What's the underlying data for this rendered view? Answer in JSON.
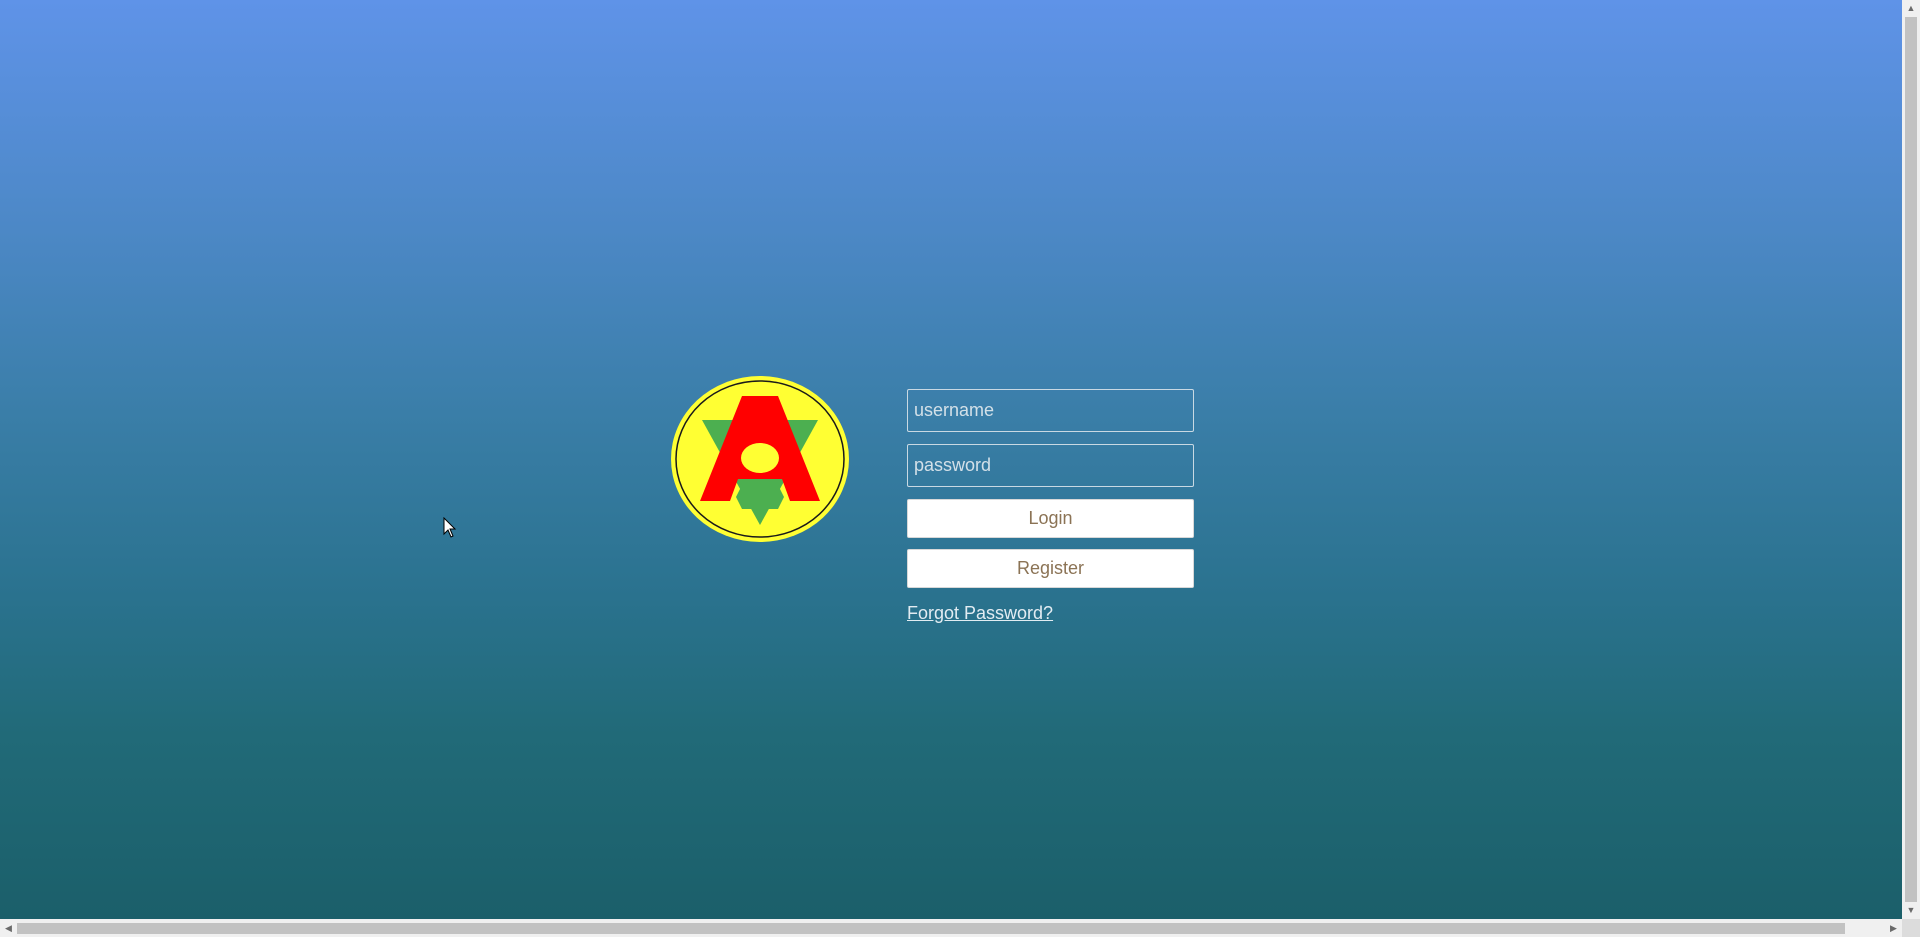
{
  "logo": {
    "icon": "club-emblem-logo",
    "letter": "A",
    "colors": {
      "circle": "#ffff33",
      "letter": "#ff0000",
      "accents": "#4caf50",
      "outline": "#000000"
    }
  },
  "form": {
    "username_placeholder": "username",
    "password_placeholder": "password",
    "login_label": "Login",
    "register_label": "Register",
    "forgot_label": "Forgot Password?"
  },
  "theme": {
    "gradient_top": "#5f93e8",
    "gradient_bottom": "#1b5f6a",
    "button_text": "#8b7355"
  }
}
